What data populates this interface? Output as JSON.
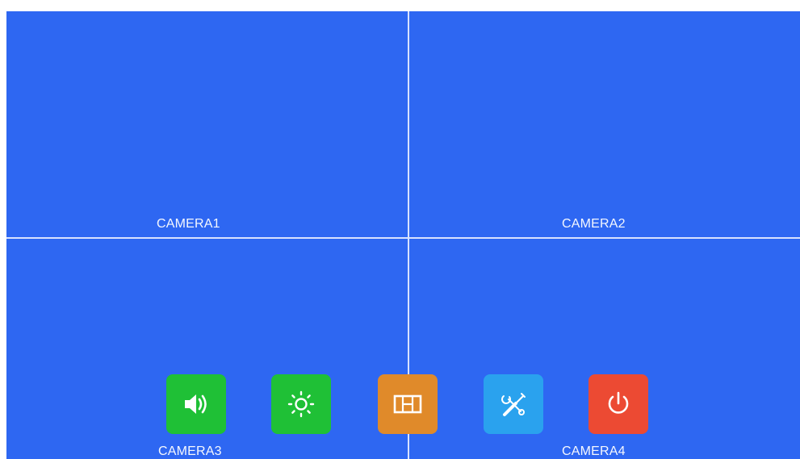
{
  "cameras": [
    {
      "label": "CAMERA1"
    },
    {
      "label": "CAMERA2"
    },
    {
      "label": "CAMERA3"
    },
    {
      "label": "CAMERA4"
    }
  ],
  "toolbar": {
    "buttons": [
      {
        "icon": "volume-icon",
        "color": "#1fc036"
      },
      {
        "icon": "brightness-icon",
        "color": "#1fc036"
      },
      {
        "icon": "split-screen-icon",
        "color": "#e08a2a"
      },
      {
        "icon": "settings-tools-icon",
        "color": "#2aa2ee"
      },
      {
        "icon": "power-icon",
        "color": "#ec4a33"
      }
    ]
  },
  "colors": {
    "background": "#2e67f2",
    "divider": "#d8e2ff"
  }
}
